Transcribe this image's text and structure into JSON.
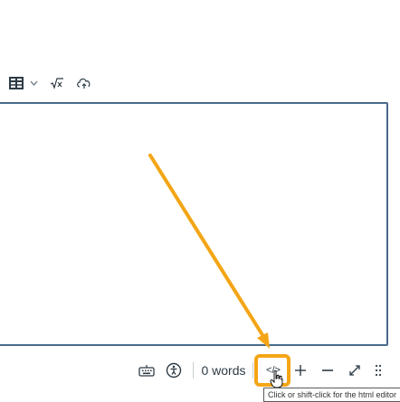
{
  "toolbar": {
    "items": [
      {
        "name": "table-icon"
      },
      {
        "name": "chevron-down-icon"
      },
      {
        "name": "equation-icon"
      },
      {
        "name": "cloud-upload-icon"
      }
    ]
  },
  "editor": {
    "content": ""
  },
  "statusbar": {
    "word_count": "0 words",
    "html_editor_label": "</>"
  },
  "tooltip": {
    "text": "Click or shift-click for the html editor"
  },
  "colors": {
    "accent_highlight": "#f4a515",
    "editor_border": "#4a6a8a",
    "text": "#2d3b45"
  }
}
